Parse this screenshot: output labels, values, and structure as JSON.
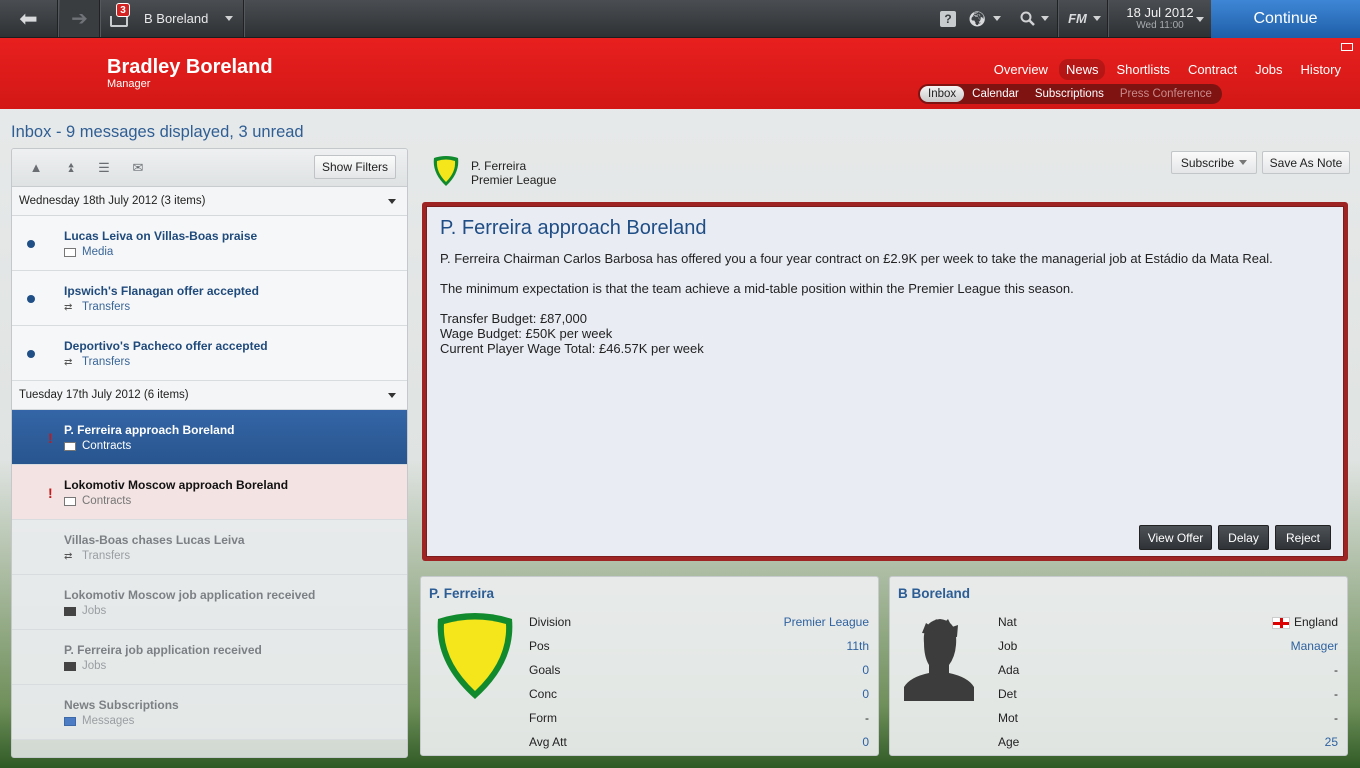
{
  "topbar": {
    "unread_badge": "3",
    "manager_select": "B Boreland",
    "help_label": "?",
    "fm_label": "FM",
    "date": "18 Jul 2012",
    "time": "Wed 11:00",
    "continue_label": "Continue"
  },
  "header": {
    "name": "Bradley Boreland",
    "role": "Manager",
    "nav": [
      "Overview",
      "News",
      "Shortlists",
      "Contract",
      "Jobs",
      "History"
    ],
    "active_nav": "News",
    "subnav": [
      "Inbox",
      "Calendar",
      "Subscriptions",
      "Press Conference"
    ],
    "active_subnav": "Inbox",
    "disabled_subnav": "Press Conference"
  },
  "inbox": {
    "title": "Inbox - 9 messages displayed, 3 unread",
    "show_filters_label": "Show Filters",
    "groups": [
      {
        "label": "Wednesday 18th July 2012 (3 items)",
        "messages": [
          {
            "subject": "Lucas Leiva on Villas-Boas praise",
            "category": "Media",
            "state": "unread",
            "icon": "newspaper-icon"
          },
          {
            "subject": "Ipswich's Flanagan offer accepted",
            "category": "Transfers",
            "state": "unread",
            "icon": "transfer-icon"
          },
          {
            "subject": "Deportivo's Pacheco offer accepted",
            "category": "Transfers",
            "state": "unread",
            "icon": "transfer-icon"
          }
        ]
      },
      {
        "label": "Tuesday 17th July 2012 (6 items)",
        "messages": [
          {
            "subject": "P. Ferreira approach Boreland",
            "category": "Contracts",
            "state": "selected",
            "icon": "contract-icon"
          },
          {
            "subject": "Lokomotiv Moscow approach Boreland",
            "category": "Contracts",
            "state": "important",
            "icon": "contract-icon"
          },
          {
            "subject": "Villas-Boas chases Lucas Leiva",
            "category": "Transfers",
            "state": "read",
            "icon": "transfer-icon"
          },
          {
            "subject": "Lokomotiv Moscow job application received",
            "category": "Jobs",
            "state": "read",
            "icon": "briefcase-icon"
          },
          {
            "subject": "P. Ferreira job application received",
            "category": "Jobs",
            "state": "read",
            "icon": "briefcase-icon"
          },
          {
            "subject": "News Subscriptions",
            "category": "Messages",
            "state": "read",
            "icon": "messages-icon"
          }
        ]
      }
    ]
  },
  "message": {
    "from_name": "P. Ferreira",
    "from_competition": "Premier League",
    "subscribe_label": "Subscribe",
    "save_note_label": "Save As Note",
    "title": "P. Ferreira approach Boreland",
    "para1": "P. Ferreira Chairman Carlos Barbosa has offered you a four year contract on £2.9K per week to take the managerial job at Estádio da Mata Real.",
    "para2": "The minimum expectation is that the team achieve a mid-table position within the Premier League this season.",
    "transfer_budget": "Transfer Budget: £87,000",
    "wage_budget": "Wage Budget: £50K per week",
    "wage_total": "Current Player Wage Total: £46.57K per week",
    "view_offer_label": "View Offer",
    "delay_label": "Delay",
    "reject_label": "Reject"
  },
  "club_panel": {
    "title": "P. Ferreira",
    "rows": [
      {
        "label": "Division",
        "value": "Premier League"
      },
      {
        "label": "Pos",
        "value": "11th"
      },
      {
        "label": "Goals",
        "value": "0"
      },
      {
        "label": "Conc",
        "value": "0"
      },
      {
        "label": "Form",
        "value": "-"
      },
      {
        "label": "Avg Att",
        "value": "0"
      }
    ]
  },
  "person_panel": {
    "title": "B Boreland",
    "rows": [
      {
        "label": "Nat",
        "value": "England"
      },
      {
        "label": "Job",
        "value": "Manager"
      },
      {
        "label": "Ada",
        "value": "-"
      },
      {
        "label": "Det",
        "value": "-"
      },
      {
        "label": "Mot",
        "value": "-"
      },
      {
        "label": "Age",
        "value": "25"
      }
    ]
  },
  "colors": {
    "header_red": "#d21715",
    "accent_blue": "#2f5e94",
    "continue_blue": "#1f5ea8",
    "crest_yellow": "#f4e61a",
    "crest_green": "#118a2e"
  }
}
